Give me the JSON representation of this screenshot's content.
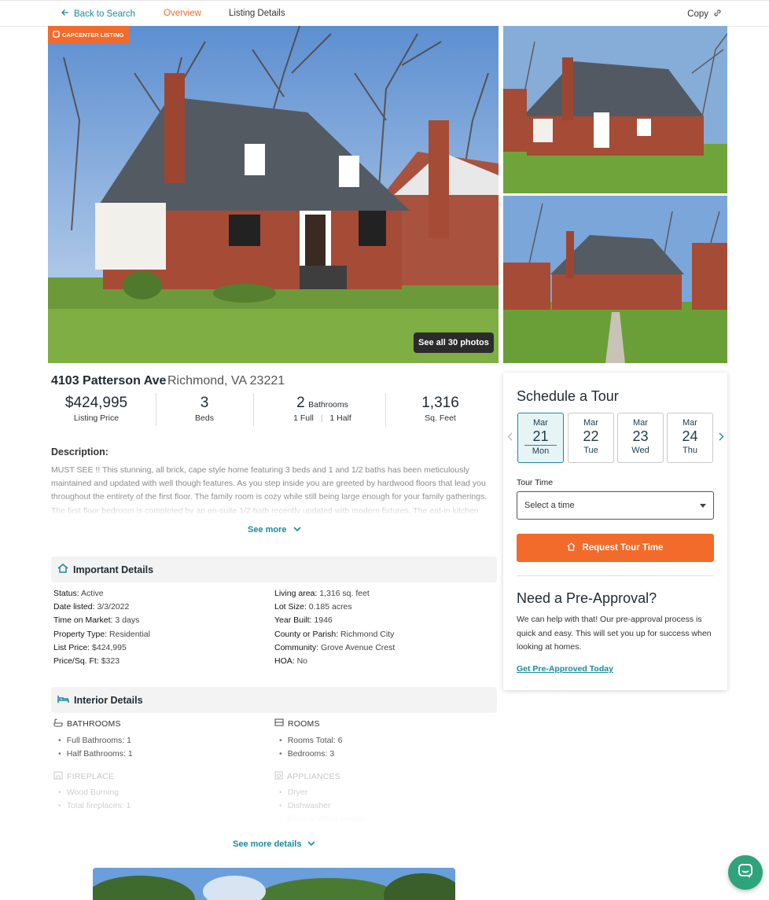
{
  "nav": {
    "back_label": "Back to Search",
    "tab_overview": "Overview",
    "tab_details": "Listing Details",
    "copy_label": "Copy"
  },
  "photos": {
    "badge": "CAPCENTER LISTING",
    "see_all": "See all 30 photos"
  },
  "listing": {
    "address": "4103 Patterson Ave",
    "city": "Richmond, VA 23221",
    "price": "$424,995",
    "price_label": "Listing Price",
    "beds": "3",
    "beds_label": "Beds",
    "baths": "2",
    "baths_label": "Bathrooms",
    "full_baths": "1 Full",
    "half_baths": "1 Half",
    "sqft": "1,316",
    "sqft_label": "Sq. Feet"
  },
  "description": {
    "title": "Description:",
    "text": "MUST SEE !! This stunning, all brick, cape style home featuring 3 beds and 1 and 1/2 baths has been meticulously maintained and updated with well though features. As you step inside you are greeted by hardwood floors that lead you throughout the entirety of the first floor. The family room is cozy while still being large enough for your family gatherings. The first floor bedroom is completed by an en-suite 1/2 bath recently updated with modern fixtures. The eat-in kitchen",
    "see_more": "See more"
  },
  "important": {
    "title": "Important Details",
    "left": [
      {
        "label": "Status:",
        "value": "Active"
      },
      {
        "label": "Date listed:",
        "value": "3/3/2022"
      },
      {
        "label": "Time on Market:",
        "value": "3 days"
      },
      {
        "label": "Property Type:",
        "value": "Residential"
      },
      {
        "label": "List Price:",
        "value": "$424,995"
      },
      {
        "label": "Price/Sq. Ft:",
        "value": "$323"
      }
    ],
    "right": [
      {
        "label": "Living area:",
        "value": "1,316 sq. feet"
      },
      {
        "label": "Lot Size:",
        "value": "0.185 acres"
      },
      {
        "label": "Year Built:",
        "value": "1946"
      },
      {
        "label": "County or Parish:",
        "value": "Richmond City"
      },
      {
        "label": "Community:",
        "value": "Grove Avenue Crest"
      },
      {
        "label": "HOA:",
        "value": "No"
      }
    ]
  },
  "interior": {
    "title": "Interior Details",
    "bathrooms_title": "BATHROOMS",
    "bathrooms": [
      "Full Bathrooms: 1",
      "Half Bathrooms: 1"
    ],
    "rooms_title": "ROOMS",
    "rooms": [
      "Rooms Total: 6",
      "Bedrooms: 3"
    ],
    "fireplace_title": "FIREPLACE",
    "fireplace": [
      "Wood Burning",
      "Total fireplaces: 1"
    ],
    "appliances_title": "APPLIANCES",
    "appliances": [
      "Dryer",
      "Dishwasher",
      "Electric Water Heater"
    ],
    "see_more": "See more details"
  },
  "tour": {
    "title": "Schedule a Tour",
    "days": [
      {
        "month": "Mar",
        "day": "21",
        "weekday": "Mon",
        "selected": true
      },
      {
        "month": "Mar",
        "day": "22",
        "weekday": "Tue",
        "selected": false
      },
      {
        "month": "Mar",
        "day": "23",
        "weekday": "Wed",
        "selected": false
      },
      {
        "month": "Mar",
        "day": "24",
        "weekday": "Thu",
        "selected": false
      }
    ],
    "time_label": "Tour Time",
    "time_placeholder": "Select a time",
    "request_button": "Request Tour Time"
  },
  "preapproval": {
    "title": "Need a Pre-Approval?",
    "text": "We can help with that! Our pre-approval process is quick and easy. This will set you up for success when looking at homes.",
    "link": "Get Pre-Approved Today"
  },
  "colors": {
    "accent": "#1a8a9c",
    "brand_orange": "#f26b2a",
    "chat_green": "#2fa37c"
  }
}
